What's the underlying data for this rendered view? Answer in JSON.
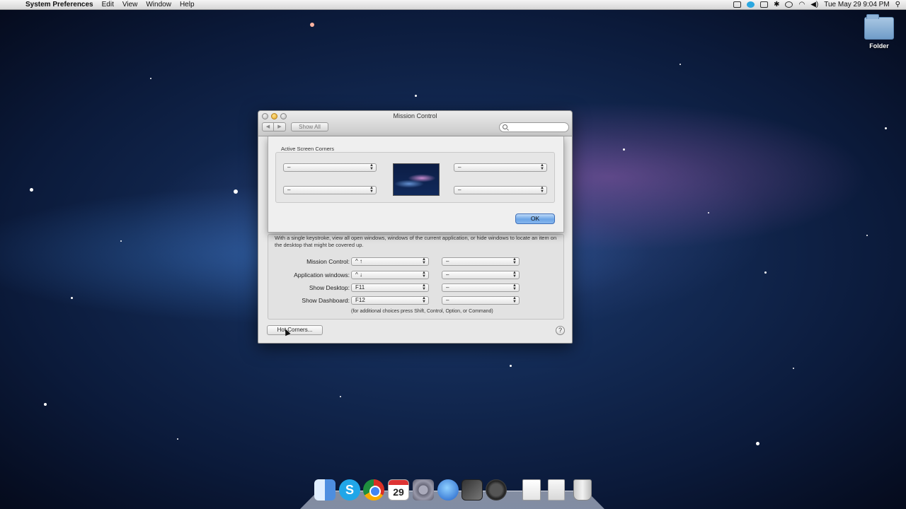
{
  "menubar": {
    "apple": "",
    "items": [
      "System Preferences",
      "Edit",
      "View",
      "Window",
      "Help"
    ],
    "clock": "Tue May 29  9:04 PM",
    "status_icons": [
      "recording-icon",
      "skype-status-icon",
      "display-icon",
      "bluetooth-icon",
      "time-machine-icon",
      "wifi-icon",
      "volume-icon",
      "spotlight-icon"
    ]
  },
  "desktop": {
    "folder_label": "Folder"
  },
  "window": {
    "title": "Mission Control",
    "nav_back": "◀",
    "nav_forward": "▶",
    "show_all": "Show All",
    "search_placeholder": "",
    "description": "With a single keystroke, view all open windows, windows of the current application, or hide windows to locate an item on the desktop that might be covered up.",
    "shortcuts": [
      {
        "label": "Mission Control:",
        "key": "^ ↑",
        "modifier": "–"
      },
      {
        "label": "Application windows:",
        "key": "^ ↓",
        "modifier": "–"
      },
      {
        "label": "Show Desktop:",
        "key": "F11",
        "modifier": "–"
      },
      {
        "label": "Show Dashboard:",
        "key": "F12",
        "modifier": "–"
      }
    ],
    "hint": "(for additional choices press Shift, Control, Option, or Command)",
    "hot_corners_button": "Hot Corners...",
    "help_button": "?"
  },
  "sheet": {
    "title": "Active Screen Corners",
    "corners": {
      "top_left": "–",
      "top_right": "–",
      "bottom_left": "–",
      "bottom_right": "–"
    },
    "ok_button": "OK"
  },
  "dock": {
    "items": [
      "finder-icon",
      "skype-icon",
      "chrome-icon",
      "calendar-icon",
      "system-preferences-icon",
      "itunes-icon",
      "final-cut-icon",
      "imovie-icon",
      "documents-icon",
      "applications-icon",
      "trash-icon"
    ],
    "calendar_day": "29"
  }
}
